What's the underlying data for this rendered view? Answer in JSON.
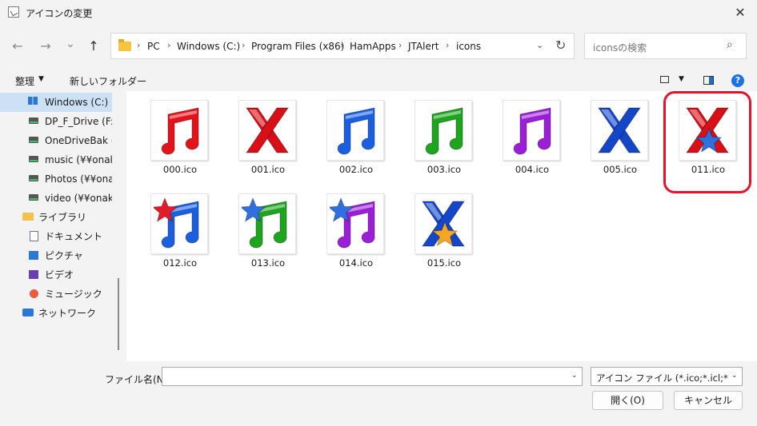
{
  "window": {
    "title": "アイコンの変更",
    "close_glyph": "✕"
  },
  "nav": {
    "back_glyph": "←",
    "forward_glyph": "→",
    "recent_glyph": "⌄",
    "up_glyph": "↑"
  },
  "address": {
    "crumbs": [
      "PC",
      "Windows (C:)",
      "Program Files (x86)",
      "HamApps",
      "JTAlert",
      "icons"
    ],
    "separator": "›",
    "dropdown_glyph": "⌄",
    "refresh_glyph": "↻"
  },
  "search": {
    "placeholder": "iconsの検索",
    "icon_glyph": "⌕"
  },
  "toolbar": {
    "organize": "整理",
    "organize_caret": "▼",
    "new_folder": "新しいフォルダー",
    "view_caret": "▼",
    "help": "?"
  },
  "sidebar": {
    "items": [
      {
        "label": "Windows (C:)",
        "icon": "windows-drive-icon"
      },
      {
        "label": "DP_F_Drive (F:)",
        "icon": "drive-icon"
      },
      {
        "label": "OneDriveBak (¥¥",
        "icon": "network-drive-icon"
      },
      {
        "label": "music (¥¥onaka_",
        "icon": "network-drive-icon"
      },
      {
        "label": "Photos (¥¥onaka",
        "icon": "network-drive-icon"
      },
      {
        "label": "video (¥¥onaka_",
        "icon": "network-drive-icon"
      },
      {
        "label": "ライブラリ",
        "icon": "library-icon"
      },
      {
        "label": "ドキュメント",
        "icon": "documents-icon"
      },
      {
        "label": "ピクチャ",
        "icon": "pictures-icon"
      },
      {
        "label": "ビデオ",
        "icon": "videos-icon"
      },
      {
        "label": "ミュージック",
        "icon": "music-icon"
      },
      {
        "label": "ネットワーク",
        "icon": "network-icon"
      }
    ]
  },
  "files": [
    {
      "name": "000.ico",
      "shape": "note",
      "color": "#e3121b",
      "star": ""
    },
    {
      "name": "001.ico",
      "shape": "x",
      "color": "#d80f17",
      "star": ""
    },
    {
      "name": "002.ico",
      "shape": "note",
      "color": "#1a5fe0",
      "star": ""
    },
    {
      "name": "003.ico",
      "shape": "note",
      "color": "#1ea51e",
      "star": ""
    },
    {
      "name": "004.ico",
      "shape": "note",
      "color": "#9b1fd6",
      "star": ""
    },
    {
      "name": "005.ico",
      "shape": "x",
      "color": "#1446c8",
      "star": ""
    },
    {
      "name": "011.ico",
      "shape": "x",
      "color": "#d80f17",
      "star": "#2f6fe0"
    },
    {
      "name": "012.ico",
      "shape": "note",
      "color": "#1a5fe0",
      "star": "#e31b2b"
    },
    {
      "name": "013.ico",
      "shape": "note",
      "color": "#1ea51e",
      "star": "#2f6fe0"
    },
    {
      "name": "014.ico",
      "shape": "note",
      "color": "#9b1fd6",
      "star": "#2f6fe0"
    },
    {
      "name": "015.ico",
      "shape": "x",
      "color": "#1446c8",
      "star": "#f5a623"
    }
  ],
  "bottom": {
    "filename_label": "ファイル名(N):",
    "filename_value": "",
    "filetype": "アイコン ファイル (*.ico;*.icl;*.exe;*.",
    "open_button": "開く(O)",
    "cancel_button": "キャンセル",
    "caret": "⌄"
  },
  "colors": {
    "selection": "#cce1f5",
    "highlight_ring": "#e3142c",
    "accent": "#1a73e8"
  }
}
